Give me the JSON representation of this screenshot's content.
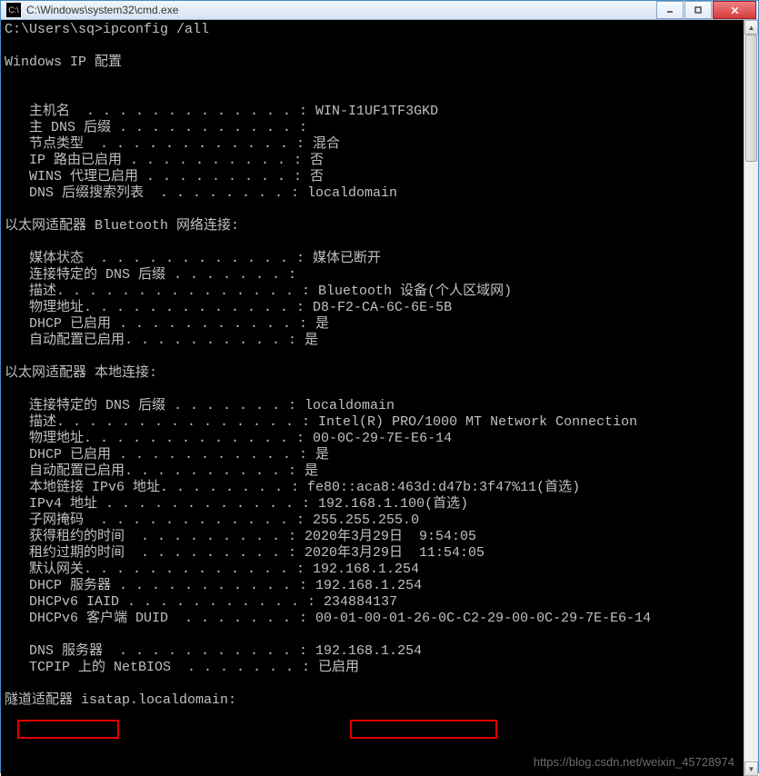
{
  "window": {
    "title": "C:\\Windows\\system32\\cmd.exe"
  },
  "terminal": {
    "prompt_line": "C:\\Users\\sq>ipconfig /all",
    "blank": "",
    "section_ipconfig": "Windows IP 配置",
    "host_name": "   主机名  . . . . . . . . . . . . . : WIN-I1UF1TF3GKD",
    "primary_dns": "   主 DNS 后缀 . . . . . . . . . . . :",
    "node_type": "   节点类型  . . . . . . . . . . . . : 混合",
    "ip_routing": "   IP 路由已启用 . . . . . . . . . . : 否",
    "wins_proxy": "   WINS 代理已启用 . . . . . . . . . : 否",
    "dns_suffix_list": "   DNS 后缀搜索列表  . . . . . . . . : localdomain",
    "section_bt": "以太网适配器 Bluetooth 网络连接:",
    "bt_media": "   媒体状态  . . . . . . . . . . . . : 媒体已断开",
    "bt_conn_dns": "   连接特定的 DNS 后缀 . . . . . . . :",
    "bt_desc": "   描述. . . . . . . . . . . . . . . : Bluetooth 设备(个人区域网)",
    "bt_phys": "   物理地址. . . . . . . . . . . . . : D8-F2-CA-6C-6E-5B",
    "bt_dhcp": "   DHCP 已启用 . . . . . . . . . . . : 是",
    "bt_autocfg": "   自动配置已启用. . . . . . . . . . : 是",
    "section_local": "以太网适配器 本地连接:",
    "lc_conn_dns": "   连接特定的 DNS 后缀 . . . . . . . : localdomain",
    "lc_desc": "   描述. . . . . . . . . . . . . . . : Intel(R) PRO/1000 MT Network Connection",
    "lc_phys": "   物理地址. . . . . . . . . . . . . : 00-0C-29-7E-E6-14",
    "lc_dhcp": "   DHCP 已启用 . . . . . . . . . . . : 是",
    "lc_autocfg": "   自动配置已启用. . . . . . . . . . : 是",
    "lc_ipv6": "   本地链接 IPv6 地址. . . . . . . . : fe80::aca8:463d:d47b:3f47%11(首选)",
    "lc_ipv4": "   IPv4 地址 . . . . . . . . . . . . : 192.168.1.100(首选)",
    "lc_subnet": "   子网掩码  . . . . . . . . . . . . : 255.255.255.0",
    "lc_lease_obt": "   获得租约的时间  . . . . . . . . . : 2020年3月29日  9:54:05",
    "lc_lease_exp": "   租约过期的时间  . . . . . . . . . : 2020年3月29日  11:54:05",
    "lc_gateway": "   默认网关. . . . . . . . . . . . . : 192.168.1.254",
    "lc_dhcp_srv": "   DHCP 服务器 . . . . . . . . . . . : 192.168.1.254",
    "lc_dhcpv6_iaid": "   DHCPv6 IAID . . . . . . . . . . . : 234884137",
    "lc_dhcpv6_duid": "   DHCPv6 客户端 DUID  . . . . . . . : 00-01-00-01-26-0C-C2-29-00-0C-29-7E-E6-14",
    "lc_dns": "   DNS 服务器  . . . . . . . . . . . : 192.168.1.254",
    "lc_netbios": "   TCPIP 上的 NetBIOS  . . . . . . . : 已启用",
    "section_tunnel": "隧道适配器 isatap.localdomain:"
  },
  "watermark": "https://blog.csdn.net/weixin_45728974"
}
